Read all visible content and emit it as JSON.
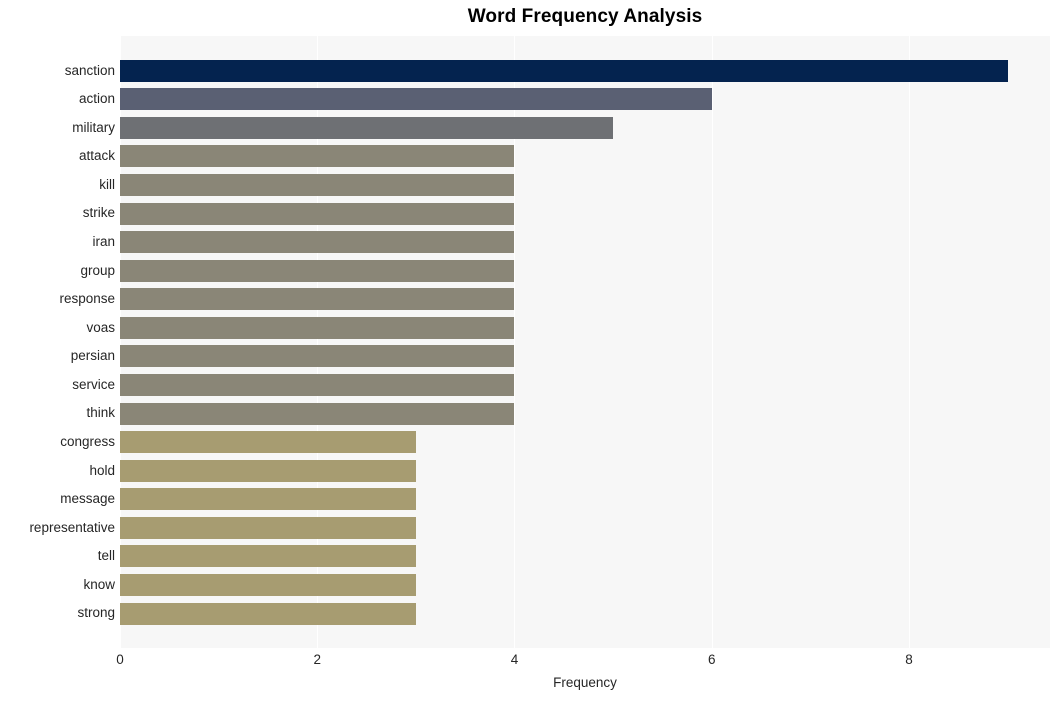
{
  "chart": {
    "title": "Word Frequency Analysis",
    "xlabel": "Frequency",
    "ylabel": ""
  },
  "chart_data": {
    "type": "bar",
    "orientation": "horizontal",
    "title": "Word Frequency Analysis",
    "xlabel": "Frequency",
    "ylabel": "",
    "categories": [
      "sanction",
      "action",
      "military",
      "attack",
      "kill",
      "strike",
      "iran",
      "group",
      "response",
      "voas",
      "persian",
      "service",
      "think",
      "congress",
      "hold",
      "message",
      "representative",
      "tell",
      "know",
      "strong"
    ],
    "values": [
      9,
      6,
      5,
      4,
      4,
      4,
      4,
      4,
      4,
      4,
      4,
      4,
      4,
      3,
      3,
      3,
      3,
      3,
      3,
      3
    ],
    "bar_colors": [
      "#04234f",
      "#5a6073",
      "#6e7074",
      "#8a8677",
      "#8a8677",
      "#8a8677",
      "#8a8677",
      "#8a8677",
      "#8a8677",
      "#8a8677",
      "#8a8677",
      "#8a8677",
      "#8a8677",
      "#a79c71",
      "#a79c71",
      "#a79c71",
      "#a79c71",
      "#a79c71",
      "#a79c71",
      "#a79c71"
    ],
    "xlim": [
      0,
      9.43
    ],
    "xticks": [
      0,
      2,
      4,
      6,
      8
    ],
    "xtick_labels": [
      "0",
      "2",
      "4",
      "6",
      "8"
    ],
    "grid": true,
    "grid_axis": "x",
    "legend": false,
    "plot_background": "#f7f7f7",
    "figure_background": "#ffffff",
    "gridline_color": "#ffffff"
  }
}
